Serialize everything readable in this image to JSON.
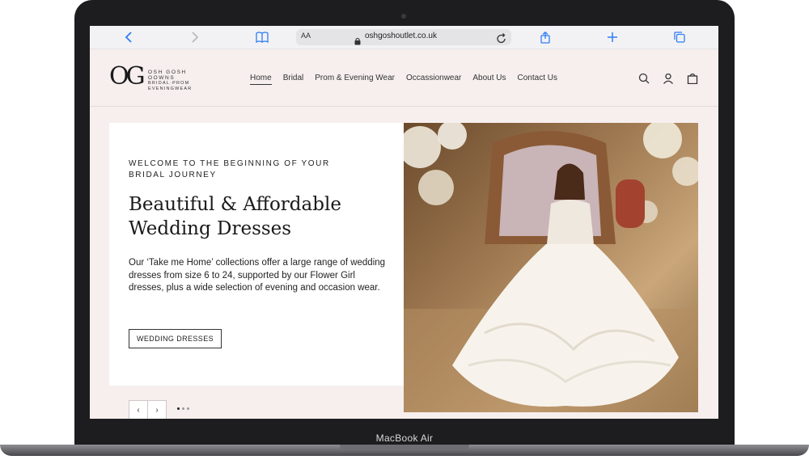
{
  "device": {
    "label": "MacBook Air"
  },
  "browser": {
    "aa_label": "AA",
    "url": "oshgoshoutlet.co.uk"
  },
  "site": {
    "logo": {
      "mark": "OG",
      "line1": "OSH GOSH",
      "line2": "OOWNS",
      "line3": "BRIDAL·PROM",
      "line4": "EVENINGWEAR"
    },
    "nav": [
      {
        "label": "Home",
        "active": true
      },
      {
        "label": "Bridal"
      },
      {
        "label": "Prom & Evening Wear"
      },
      {
        "label": "Occassionwear"
      },
      {
        "label": "About Us"
      },
      {
        "label": "Contact Us"
      }
    ]
  },
  "hero": {
    "eyebrow": "WELCOME TO THE BEGINNING OF YOUR BRIDAL JOURNEY",
    "headline": "Beautiful & Affordable Wedding Dresses",
    "body": "Our ‘Take me Home’ collections offer a large range of wedding dresses from size 6 to 24, supported by our Flower Girl dresses, plus a wide selection of evening and occasion wear.",
    "cta": "WEDDING DRESSES",
    "slider": {
      "prev": "‹",
      "next": "›",
      "slide_count": 3,
      "active_slide": 1
    }
  }
}
